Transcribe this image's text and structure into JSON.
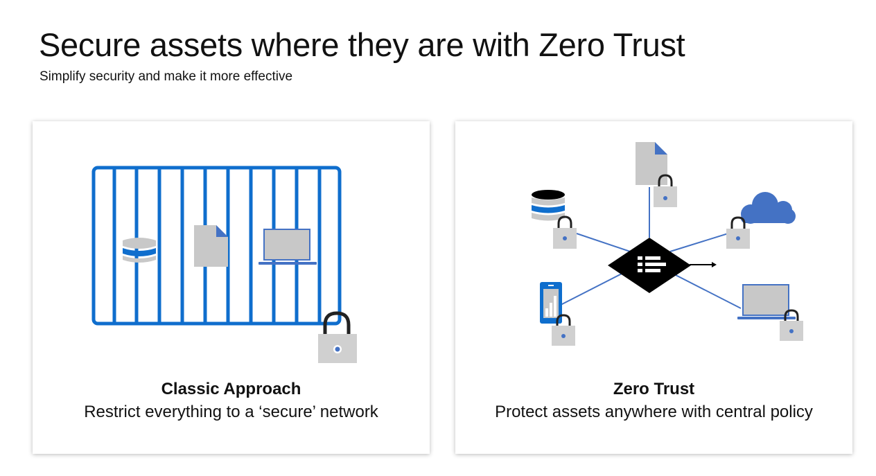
{
  "header": {
    "title": "Secure assets where they are with Zero Trust",
    "subtitle": "Simplify security and make it more effective"
  },
  "panels": [
    {
      "id": "classic",
      "title": "Classic Approach",
      "description": "Restrict everything to a ‘secure’ network",
      "icons": [
        "cage-icon",
        "database-icon",
        "document-icon",
        "laptop-icon",
        "padlock-icon"
      ]
    },
    {
      "id": "zero-trust",
      "title": "Zero Trust",
      "description": "Protect assets anywhere with central policy",
      "icons": [
        "policy-engine-icon",
        "document-icon",
        "database-icon",
        "cloud-icon",
        "phone-icon",
        "laptop-icon",
        "padlock-icon"
      ]
    }
  ],
  "colors": {
    "accent_blue": "#0f6ecd",
    "line_blue": "#4472c4",
    "cloud_blue": "#4472c4",
    "lock_gray": "#d0d0d0",
    "lock_shackle": "#222222",
    "asset_gray": "#c8c8c8",
    "engine_black": "#000000"
  }
}
